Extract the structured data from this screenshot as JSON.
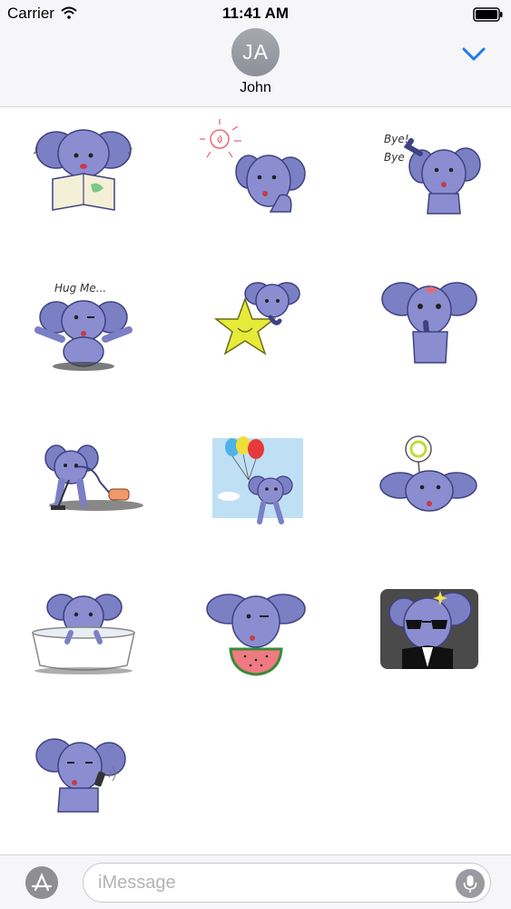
{
  "status_bar": {
    "carrier": "Carrier",
    "time": "11:41 AM"
  },
  "header": {
    "avatar_initials": "JA",
    "contact_name": "John"
  },
  "colors": {
    "accent": "#1d7cf2",
    "elephant": "#7b7fc4",
    "elephant_dark": "#5d61a6",
    "background": "#ffffff",
    "bar": "#f6f6f8"
  },
  "stickers": [
    {
      "name": "reading",
      "caption": ""
    },
    {
      "name": "sun-waving",
      "caption": ""
    },
    {
      "name": "bye-bye",
      "caption": "Bye! Bye"
    },
    {
      "name": "hug-me",
      "caption": "Hug Me..."
    },
    {
      "name": "star",
      "caption": ""
    },
    {
      "name": "shy-bow",
      "caption": ""
    },
    {
      "name": "vacuum",
      "caption": ""
    },
    {
      "name": "balloons",
      "caption": ""
    },
    {
      "name": "lollipop",
      "caption": ""
    },
    {
      "name": "bath",
      "caption": ""
    },
    {
      "name": "watermelon",
      "caption": ""
    },
    {
      "name": "sunglasses",
      "caption": ""
    },
    {
      "name": "phone-call",
      "caption": ""
    }
  ],
  "input_bar": {
    "placeholder": "iMessage",
    "value": ""
  }
}
